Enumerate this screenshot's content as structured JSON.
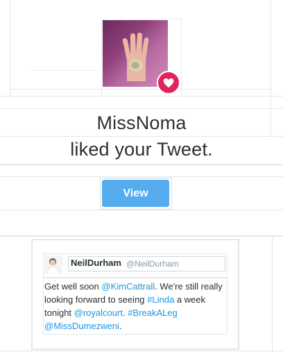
{
  "notification": {
    "line1": "MissNoma",
    "line2": "liked your Tweet."
  },
  "view_button": {
    "label": "View"
  },
  "tweet": {
    "author_name": "NeilDurham",
    "author_handle": "@NeilDurham",
    "text_segments": [
      {
        "text": "Get well soon ",
        "link": false
      },
      {
        "text": "@KimCattrall",
        "link": true
      },
      {
        "text": ". We're still really looking forward to seeing ",
        "link": false
      },
      {
        "text": "#Linda",
        "link": true
      },
      {
        "text": " a week tonight ",
        "link": false
      },
      {
        "text": "@royalcourt",
        "link": true
      },
      {
        "text": ". ",
        "link": false
      },
      {
        "text": "#BreakALeg",
        "link": true
      },
      {
        "text": " ",
        "link": false
      },
      {
        "text": "@MissDumezweni",
        "link": true
      },
      {
        "text": ".",
        "link": false
      }
    ]
  },
  "icons": {
    "badge": "heart-icon",
    "avatar": "user-avatar"
  },
  "colors": {
    "like_red": "#e0245e",
    "button_blue": "#55acee",
    "link_blue": "#1b95e0",
    "divider": "#e1e8ed"
  }
}
